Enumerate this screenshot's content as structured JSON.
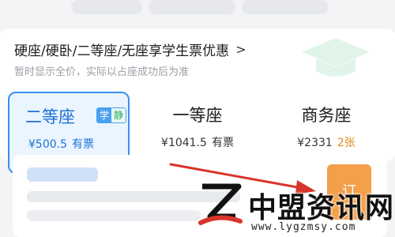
{
  "promo": {
    "text": "硬座/硬卧/二等座/无座享学生票优惠",
    "chevron": ">"
  },
  "note": "暂时显示全价，实际以占座成功后为准",
  "seats": [
    {
      "name": "二等座",
      "badge_left": "学",
      "badge_right": "静",
      "price": "¥500.5",
      "availability": "有票",
      "selected": true
    },
    {
      "name": "一等座",
      "price": "¥1041.5",
      "availability": "有票"
    },
    {
      "name": "商务座",
      "price": "¥2331",
      "availability": "2张"
    }
  ],
  "book_button": {
    "label": "订"
  },
  "watermark": {
    "title": "中盟资讯网",
    "url": "www.lygzmsy.com"
  },
  "colors": {
    "accent": "#3a8ef2",
    "count_orange": "#e08a1e",
    "book_orange": "#f2a04a",
    "arrow_red": "#d9342b"
  }
}
